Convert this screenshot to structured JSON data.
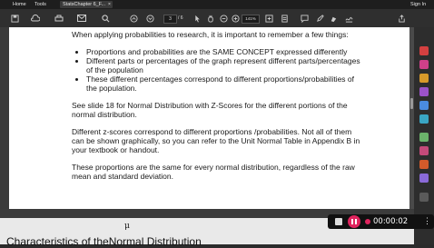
{
  "topbar": {
    "menu": [
      "Home",
      "Tools"
    ],
    "tab_title": "StatsChapter 6_F...",
    "tab_close": "×",
    "sign_in": "Sign In"
  },
  "toolbar": {
    "page_current": "3",
    "page_total": "/ 6",
    "zoom": "141%",
    "icons": [
      "save-icon",
      "cloud-icon",
      "print-icon",
      "email-icon",
      "search-icon",
      "prev-page-icon",
      "next-page-icon",
      "select-cursor-icon",
      "hand-icon",
      "zoom-out-icon",
      "zoom-in-icon",
      "fit-page-icon",
      "scroll-mode-icon",
      "comment-icon",
      "pen-icon",
      "highlight-icon",
      "sign-icon",
      "share-icon"
    ]
  },
  "document": {
    "intro": "When applying probabilities to research, it is important to remember a few things:",
    "bullets": [
      "Proportions and probabilities are the SAME CONCEPT expressed differently",
      "Different parts or percentages of the graph represent different parts/percentages of the population",
      "These different percentages correspond to different proportions/probabilities of the population."
    ],
    "para1": "See slide 18 for Normal Distribution with Z-Scores for the different portions of the normal distribution.",
    "para2": "Different z-scores correspond to different proportions /probabilities. Not all of them can be shown graphically, so you can refer to the Unit Normal Table in Appendix B in your textbook or handout.",
    "para3": "These proportions are the same for every normal distribution, regardless of the raw mean and standard deviation."
  },
  "below_page": {
    "mu_symbol": "μ",
    "heading_partial": "Characteristics of theNormal Distribution"
  },
  "recorder": {
    "time": "00:00:02",
    "menu": "⋮"
  },
  "colors": {
    "record_red": "#e0245e",
    "toolbar_bg": "#2f2f2f",
    "page_bg": "#ffffff"
  }
}
